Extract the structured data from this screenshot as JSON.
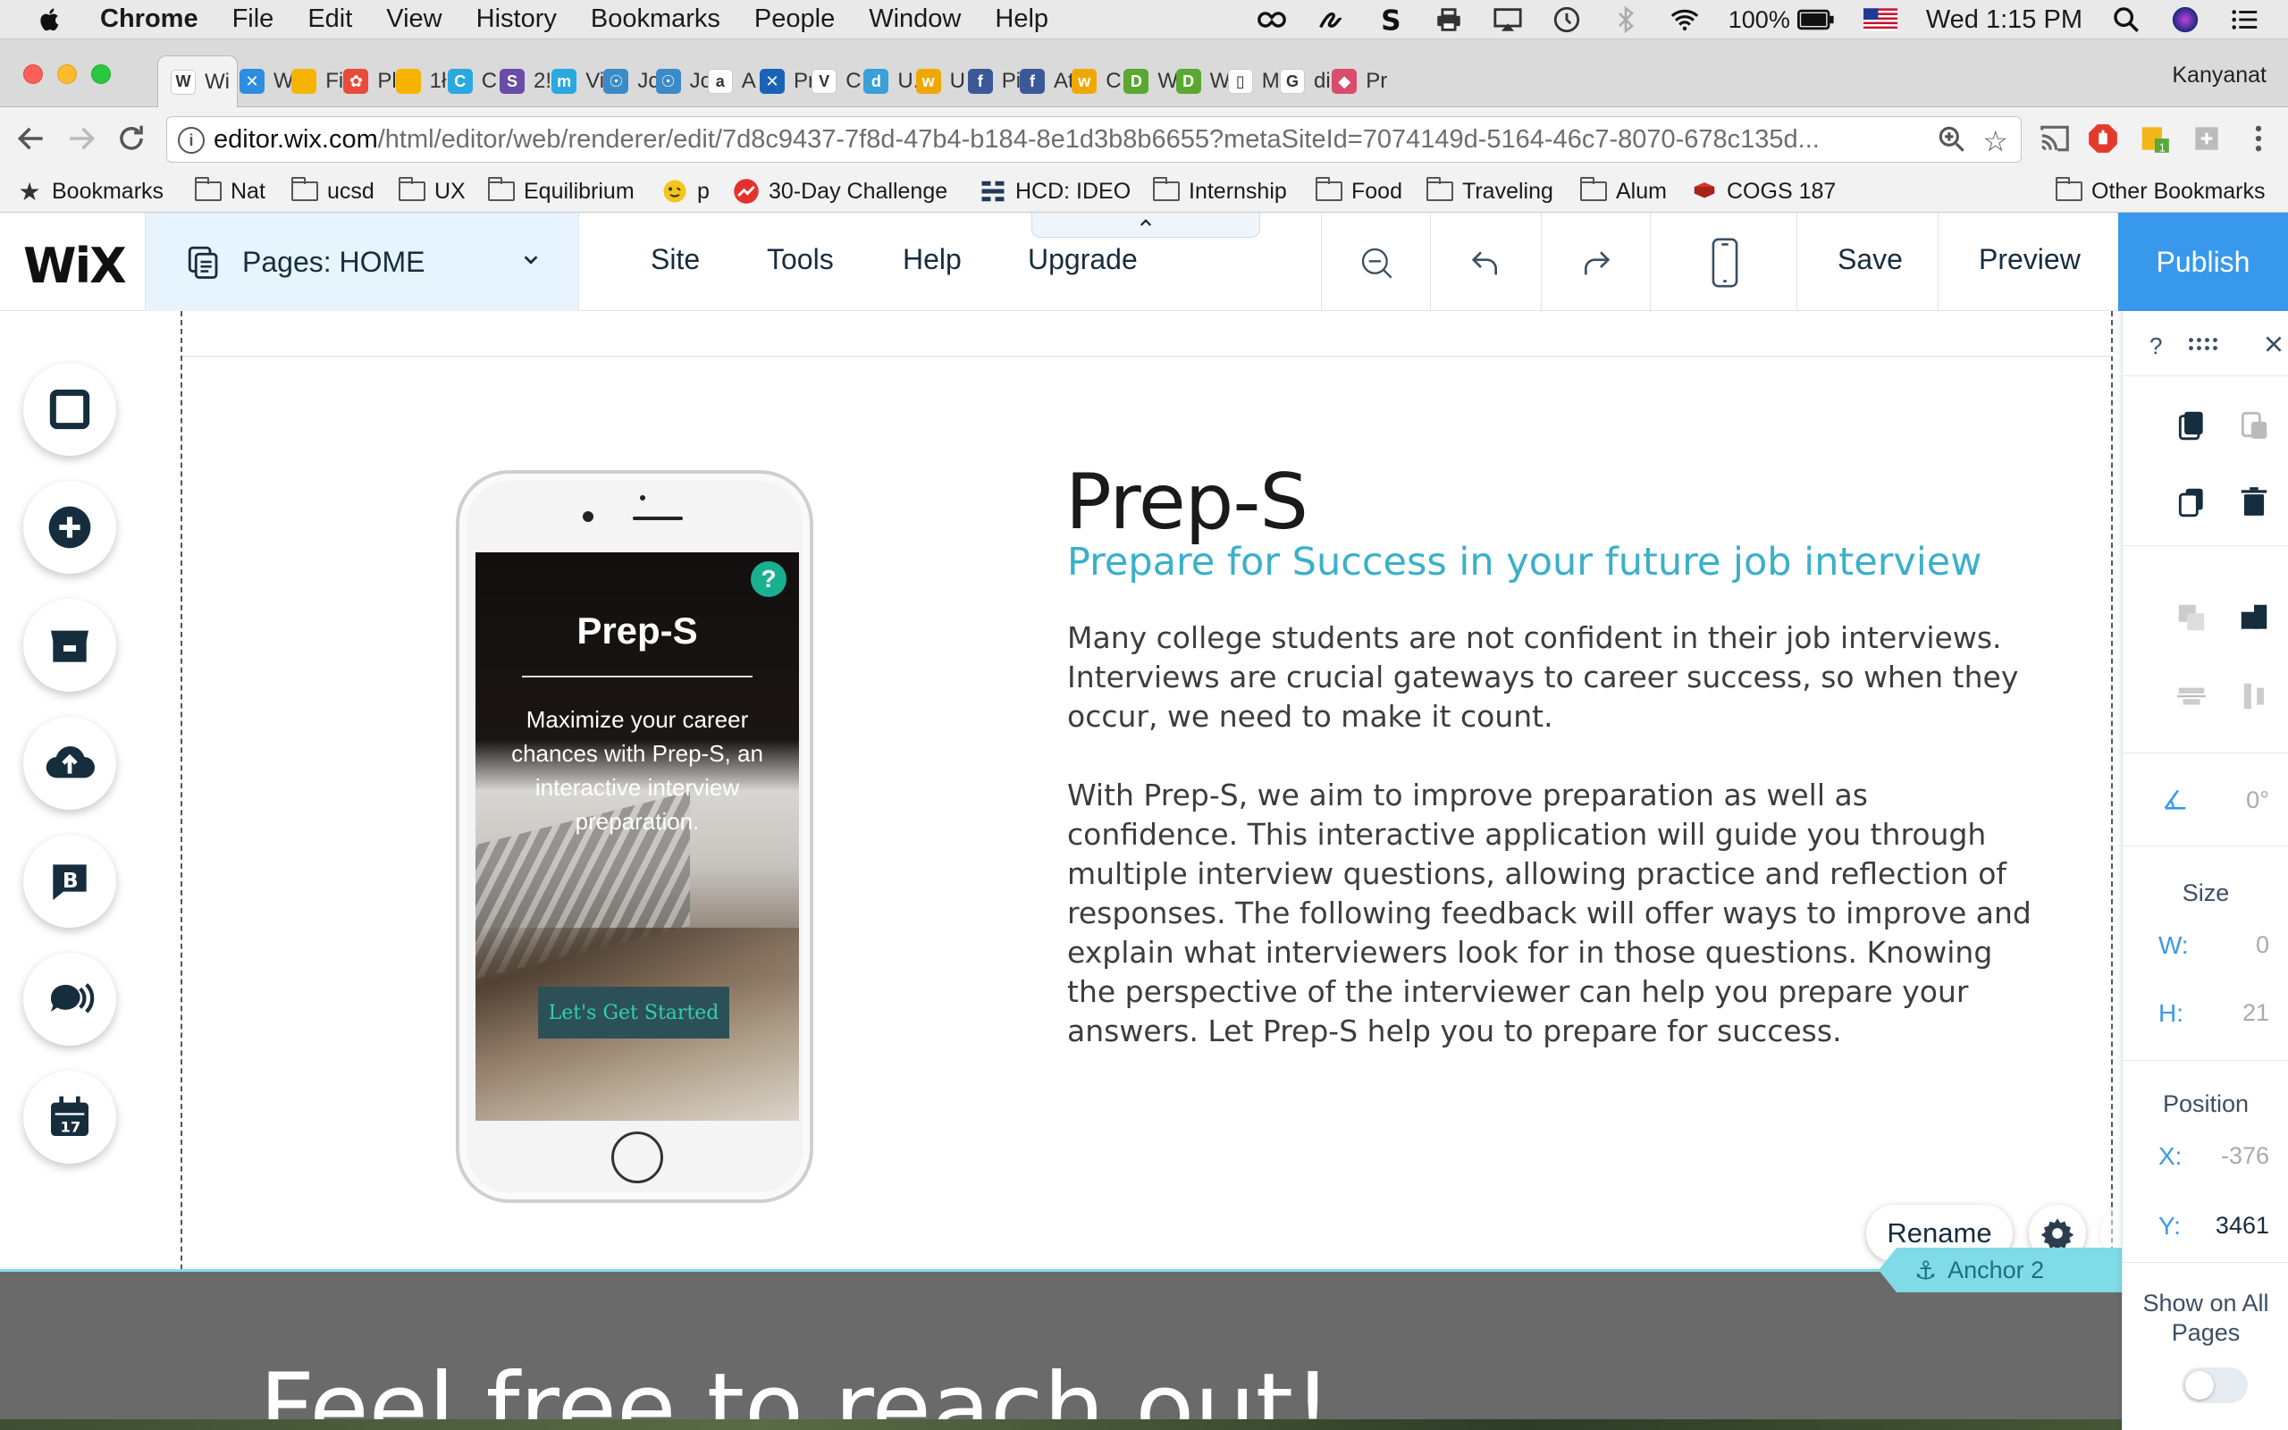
{
  "menubar": {
    "app_name": "Chrome",
    "items": [
      "File",
      "Edit",
      "View",
      "History",
      "Bookmarks",
      "People",
      "Window",
      "Help"
    ],
    "battery": "100%",
    "clock": "Wed 1:15 PM"
  },
  "tabs": [
    {
      "label": "Wi",
      "color": "#ffffff",
      "glyph": "W",
      "active": true
    },
    {
      "label": "W",
      "color": "#2d8ee0",
      "glyph": "✕"
    },
    {
      "label": "Fi",
      "color": "#f6b400",
      "glyph": ""
    },
    {
      "label": "Pl",
      "color": "#e84a3c",
      "glyph": "✿"
    },
    {
      "label": "1ł",
      "color": "#f6b400",
      "glyph": ""
    },
    {
      "label": "C",
      "color": "#2aa8e0",
      "glyph": "C"
    },
    {
      "label": "2!",
      "color": "#6b4ca8",
      "glyph": "S"
    },
    {
      "label": "Vi",
      "color": "#2aa8e0",
      "glyph": "m"
    },
    {
      "label": "Jc",
      "color": "#3a8bc8",
      "glyph": "☉"
    },
    {
      "label": "Jc",
      "color": "#3a8bc8",
      "glyph": "☉"
    },
    {
      "label": "A",
      "color": "#ffffff",
      "glyph": "a"
    },
    {
      "label": "Pr",
      "color": "#1a62b8",
      "glyph": "✕"
    },
    {
      "label": "C",
      "color": "#ffffff",
      "glyph": "V"
    },
    {
      "label": "U.",
      "color": "#3aa0d8",
      "glyph": "d"
    },
    {
      "label": "U",
      "color": "#f0a800",
      "glyph": "w"
    },
    {
      "label": "Pi",
      "color": "#3b5998",
      "glyph": "f"
    },
    {
      "label": "At",
      "color": "#3b5998",
      "glyph": "f"
    },
    {
      "label": "C",
      "color": "#f0a800",
      "glyph": "w"
    },
    {
      "label": "W",
      "color": "#5aa832",
      "glyph": "D"
    },
    {
      "label": "W",
      "color": "#5aa832",
      "glyph": "D"
    },
    {
      "label": "M",
      "color": "#ffffff",
      "glyph": "▯"
    },
    {
      "label": "di",
      "color": "#ffffff",
      "glyph": "G"
    },
    {
      "label": "Pr",
      "color": "#d84c6c",
      "glyph": "◆"
    }
  ],
  "profile_name": "Kanyanat",
  "address": {
    "host": "editor.wix.com",
    "path": "/html/editor/web/renderer/edit/7d8c9437-7f8d-47b4-b184-8e1d3b8b6655?metaSiteId=7074149d-5164-46c7-8070-678c135d..."
  },
  "bookmarks": {
    "label": "Bookmarks",
    "items": [
      "Nat",
      "ucsd",
      "UX",
      "Equilibrium",
      "p",
      "30-Day Challenge",
      "HCD: IDEO",
      "Internship",
      "Food",
      "Traveling",
      "Alum",
      "COGS 187"
    ],
    "other": "Other Bookmarks"
  },
  "wix": {
    "logo": "WiX",
    "pages_label": "Pages: HOME",
    "menu": [
      "Site",
      "Tools",
      "Help",
      "Upgrade"
    ],
    "save": "Save",
    "preview": "Preview",
    "publish": "Publish"
  },
  "phone_app": {
    "title": "Prep-S",
    "description": "Maximize your career chances with Prep-S, an interactive interview preparation.",
    "cta": "Let's Get Started",
    "help_glyph": "?"
  },
  "hero": {
    "title": "Prep-S",
    "subtitle": "Prepare for Success in your future job interview",
    "paragraph1": "Many college students are not confident in their job interviews. Interviews are crucial gateways to career success, so when they occur, we need to make it count.",
    "paragraph2": "With Prep-S, we aim to improve preparation as well as confidence. This interactive application will guide you through multiple interview questions, allowing practice and reflection of responses. The following feedback will offer ways to improve and explain what interviewers look for in those questions. Knowing the perspective of the interviewer can help you prepare your answers. Let Prep-S help you to prepare for success."
  },
  "anchor": {
    "rename": "Rename",
    "label": "Anchor 2"
  },
  "footer": {
    "headline": "Feel free to reach out!"
  },
  "inspector": {
    "help": "?",
    "rotation": "0°",
    "size_label": "Size",
    "w_label": "W:",
    "w_value": "0",
    "h_label": "H:",
    "h_value": "21",
    "position_label": "Position",
    "x_label": "X:",
    "x_value": "-376",
    "y_label": "Y:",
    "y_value": "3461",
    "show_all": "Show on All Pages"
  },
  "colors": {
    "wix_blue": "#3899ec",
    "subtitle_teal": "#3ab0c9",
    "anchor_teal": "#7fdbe8",
    "pages_bg": "#e7f3fd"
  }
}
